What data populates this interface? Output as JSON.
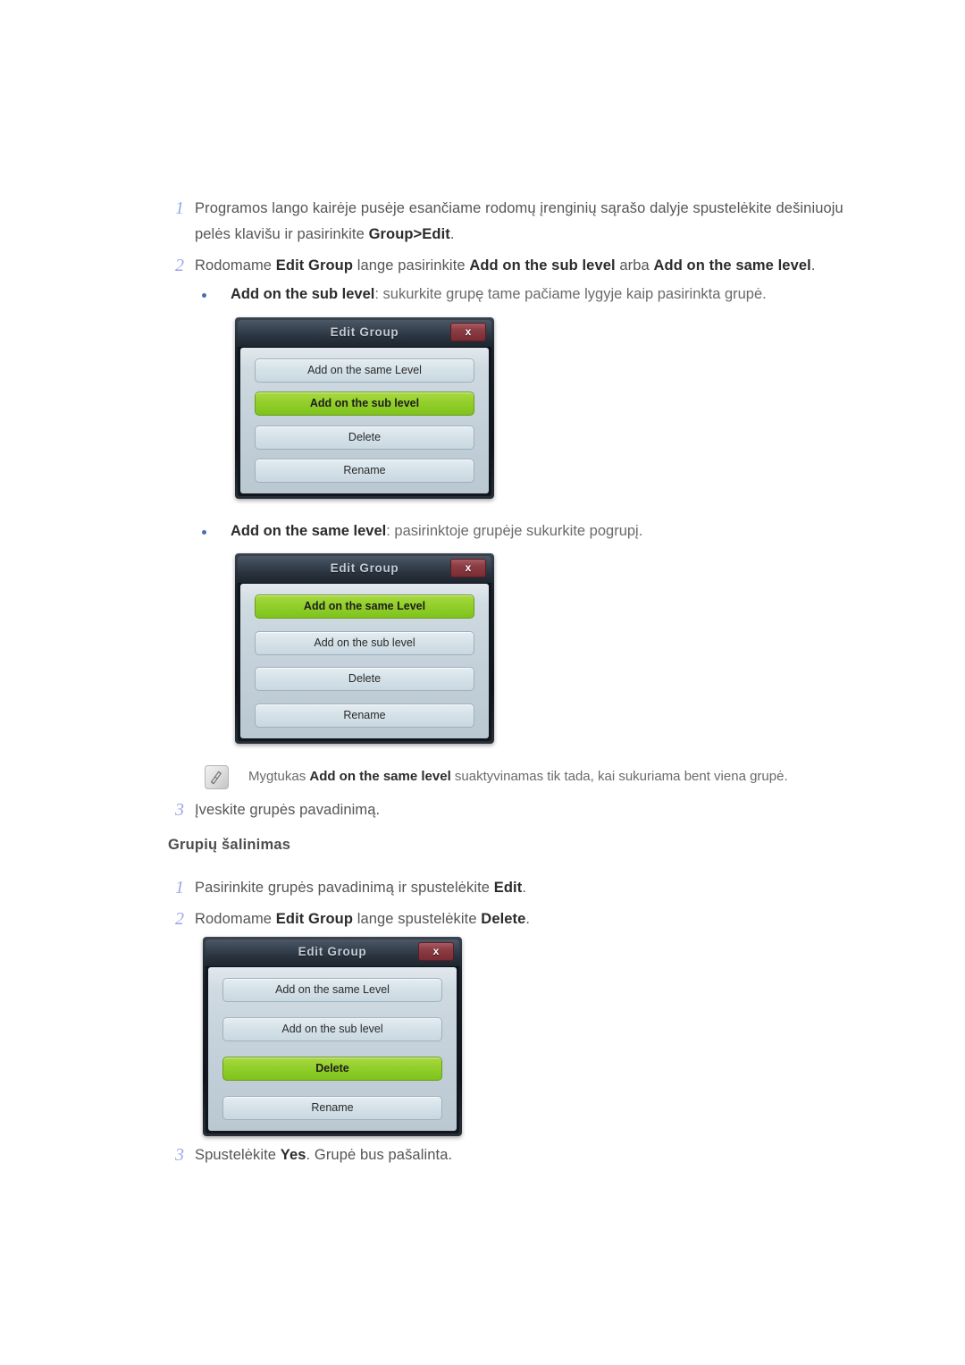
{
  "steps_group_edit": [
    {
      "num": "1",
      "html": "Programos lango kairėje pusėje esančiame rodomų įrenginių sąrašo dalyje spustelėkite dešiniuoju pelės klavišu ir pasirinkite <b>Group&gt;Edit</b>."
    },
    {
      "num": "2",
      "html": "Rodomame <b>Edit Group</b> lange pasirinkite <b>Add on the sub level</b> arba <b>Add on the same level</b>."
    }
  ],
  "bullets": [
    {
      "html": "<b>Add on the sub level</b>: sukurkite grupę tame pačiame lygyje kaip pasirinkta grupė."
    },
    {
      "html": "<b>Add on the same level</b>: pasirinktoje grupėje sukurkite pogrupį."
    }
  ],
  "note": {
    "icon": "note-pen-icon",
    "html": "Mygtukas <b>Add on the same level</b> suaktyvinamas tik tada, kai sukuriama bent viena grupė."
  },
  "step3_group_edit": {
    "num": "3",
    "html": "Įveskite grupės pavadinimą."
  },
  "section_heading": "Grupių šalinimas",
  "steps_group_delete": [
    {
      "num": "1",
      "html": "Pasirinkite grupės pavadinimą ir spustelėkite <b>Edit</b>."
    },
    {
      "num": "2",
      "html": "Rodomame <b>Edit Group</b> lange spustelėkite <b>Delete</b>."
    },
    {
      "num": "3",
      "html": "Spustelėkite <b>Yes</b>. Grupė bus pašalinta."
    }
  ],
  "dialogs": [
    {
      "title": "Edit Group",
      "close_label": "x",
      "buttons": [
        {
          "label": "Add on the same Level",
          "selected": false
        },
        {
          "label": "Add on the sub level",
          "selected": true
        },
        {
          "label": "Delete",
          "selected": false
        },
        {
          "label": "Rename",
          "selected": false
        }
      ]
    },
    {
      "title": "Edit Group",
      "close_label": "x",
      "buttons": [
        {
          "label": "Add on the same Level",
          "selected": true
        },
        {
          "label": "Add on the sub level",
          "selected": false
        },
        {
          "label": "Delete",
          "selected": false
        },
        {
          "label": "Rename",
          "selected": false
        }
      ]
    },
    {
      "title": "Edit Group",
      "close_label": "x",
      "buttons": [
        {
          "label": "Add on the same Level",
          "selected": false
        },
        {
          "label": "Add on the sub level",
          "selected": false
        },
        {
          "label": "Delete",
          "selected": true
        },
        {
          "label": "Rename",
          "selected": false
        }
      ]
    }
  ],
  "colors": {
    "step_number": "#9aa6e8",
    "bullet_dot": "#4a6fb5",
    "body_text": "#555555",
    "bold_text": "#2b2b2b",
    "dialog_selected_button": "#93cf2c",
    "dialog_close_button": "#8e3e45",
    "dialog_titlebar": "#3b4754"
  }
}
